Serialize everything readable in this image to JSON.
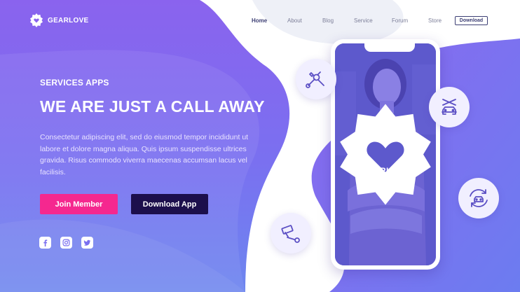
{
  "brand": {
    "name": "GEARLOVE"
  },
  "nav": {
    "items": [
      {
        "label": "Home",
        "active": true
      },
      {
        "label": "About",
        "active": false
      },
      {
        "label": "Blog",
        "active": false
      },
      {
        "label": "Service",
        "active": false
      },
      {
        "label": "Forum",
        "active": false
      },
      {
        "label": "Store",
        "active": false
      }
    ],
    "download_label": "Download"
  },
  "hero": {
    "eyebrow": "SERVICES APPS",
    "headline": "WE ARE JUST A CALL AWAY",
    "body": "Consectetur adipiscing elit, sed do eiusmod tempor incididunt ut labore et dolore magna aliqua. Quis ipsum suspendisse ultrices gravida. Risus commodo viverra maecenas accumsan lacus vel facilisis.",
    "primary_cta": "Join Member",
    "secondary_cta": "Download App"
  },
  "social": [
    "facebook-icon",
    "instagram-icon",
    "twitter-icon"
  ],
  "phone": {
    "app_name": "GEARLOVE"
  },
  "features": [
    "tools-icon",
    "car-repair-icon",
    "car-sync-icon",
    "paint-roller-icon"
  ],
  "colors": {
    "purple_start": "#8f6cf2",
    "purple_end": "#6a7ef0",
    "pink_cta": "#f5288f",
    "navy_cta": "#1c0f4c",
    "nav_active": "#3d3f74",
    "icon_stroke": "#5b4fc4"
  }
}
